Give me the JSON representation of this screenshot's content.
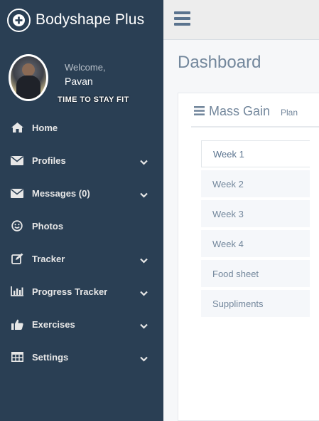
{
  "brand": {
    "title": "Bodyshape Plus",
    "icon": "plus-circle-icon"
  },
  "profile": {
    "welcome": "Welcome,",
    "name": "Pavan",
    "motto": "TIME TO STAY FIT"
  },
  "menu": [
    {
      "label": "Home",
      "icon": "home-icon",
      "expandable": false
    },
    {
      "label": "Profiles",
      "icon": "envelope-icon",
      "expandable": true
    },
    {
      "label": "Messages (0)",
      "icon": "envelope-icon",
      "expandable": true
    },
    {
      "label": "Photos",
      "icon": "smile-icon",
      "expandable": false
    },
    {
      "label": "Tracker",
      "icon": "edit-icon",
      "expandable": true
    },
    {
      "label": "Progress Tracker",
      "icon": "bar-chart-icon",
      "expandable": true
    },
    {
      "label": "Exercises",
      "icon": "thumbs-up-icon",
      "expandable": true
    },
    {
      "label": "Settings",
      "icon": "table-icon",
      "expandable": true
    }
  ],
  "page": {
    "title": "Dashboard"
  },
  "panel": {
    "title": "Mass Gain",
    "subtitle": "Plan"
  },
  "tabs": [
    {
      "label": "Week 1",
      "active": true
    },
    {
      "label": "Week 2",
      "active": false
    },
    {
      "label": "Week 3",
      "active": false
    },
    {
      "label": "Week 4",
      "active": false
    },
    {
      "label": "Food sheet",
      "active": false
    },
    {
      "label": "Suppliments",
      "active": false
    }
  ],
  "colors": {
    "sidebar": "#2a3f54",
    "text_muted": "#73879c",
    "accent": "#5a738e"
  }
}
